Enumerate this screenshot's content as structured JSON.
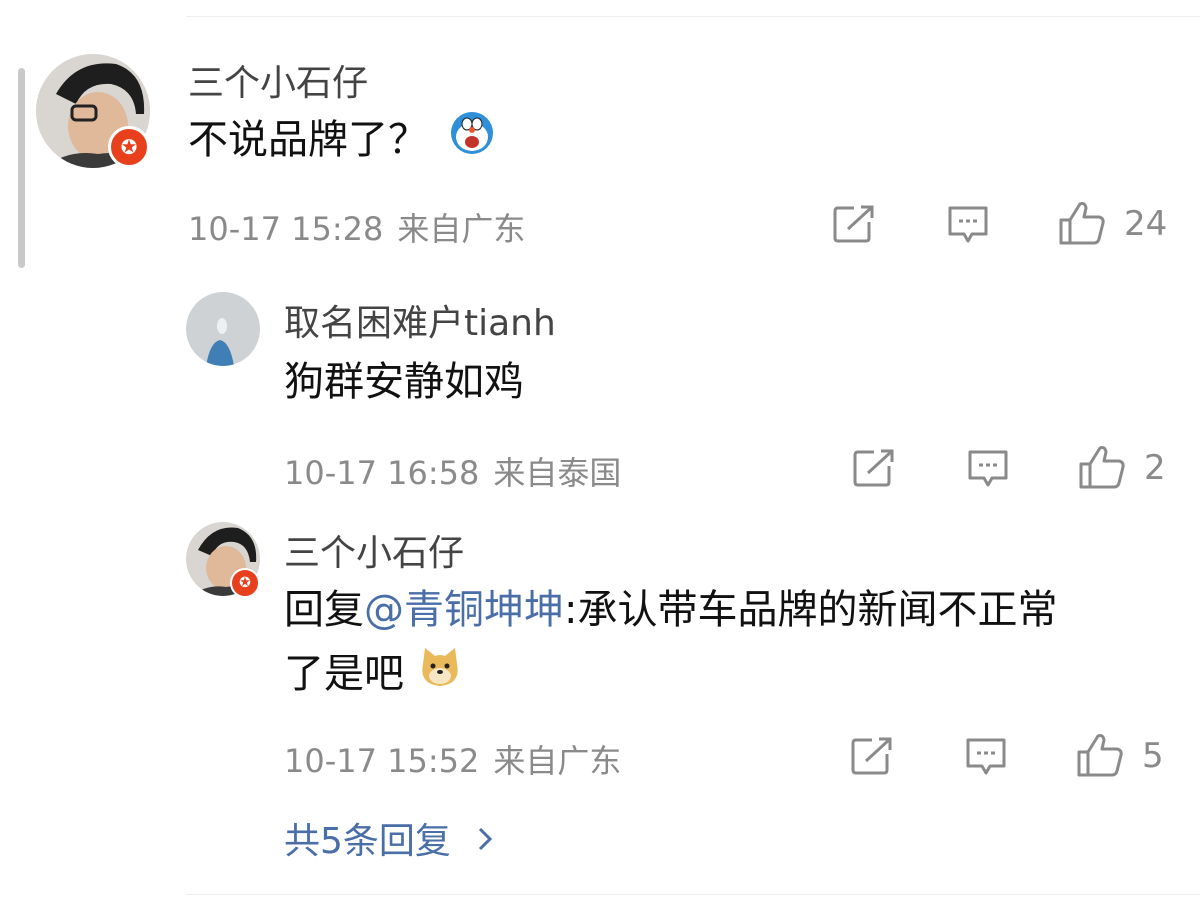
{
  "comment": {
    "username": "三个小石仔",
    "text": "不说品牌了？",
    "emoji_icon": "doraemon-emoji",
    "time": "10-17 15:28",
    "location": "来自广东",
    "likes": "24",
    "badge_icon": "star-badge-icon",
    "badge_color": "#e8401c"
  },
  "replies": [
    {
      "username": "取名困难户tianh",
      "text": "狗群安静如鸡",
      "time": "10-17 16:58",
      "location": "来自泰国",
      "likes": "2"
    },
    {
      "username": "三个小石仔",
      "reply_prefix": "回复",
      "mention": "@青铜坤坤",
      "text_line1": ":承认带车品牌的新闻不正常",
      "text_line2": "了是吧",
      "emoji_icon": "doge-emoji",
      "time": "10-17 15:52",
      "location": "来自广东",
      "likes": "5"
    }
  ],
  "more_replies": {
    "label": "共5条回复",
    "icon": "chevron-right-icon"
  },
  "colors": {
    "link": "#4a6ea8",
    "meta": "#8a8a8a",
    "badge": "#e8401c"
  }
}
